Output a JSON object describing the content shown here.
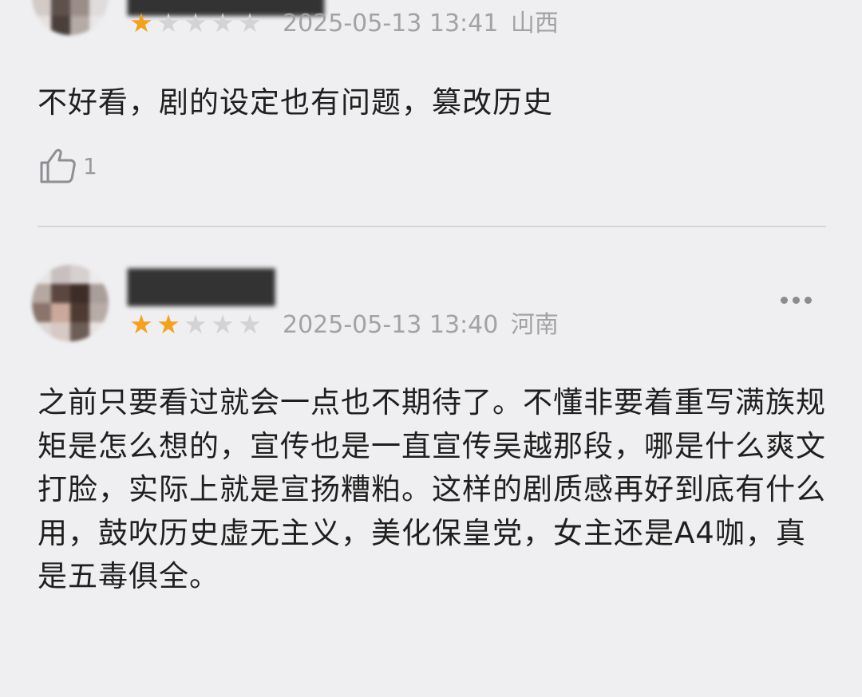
{
  "reviews": [
    {
      "rating": 1,
      "rating_max": 5,
      "timestamp": "2025-05-13 13:41",
      "location": "山西",
      "content": "不好看，剧的设定也有问题，篡改历史",
      "like_count": "1"
    },
    {
      "rating": 2,
      "rating_max": 5,
      "timestamp": "2025-05-13 13:40",
      "location": "河南",
      "content": "之前只要看过就会一点也不期待了。不懂非要着重写满族规矩是怎么想的，宣传也是一直宣传吴越那段，哪是什么爽文打脸，实际上就是宣扬糟粕。这样的剧质感再好到底有什么用，鼓吹历史虚无主义，美化保皇党，女主还是A4咖，真是五毒俱全。"
    }
  ],
  "colors": {
    "background": "#efeff1",
    "star_on": "#f4a11d",
    "star_off": "#d3d3d6",
    "meta_text": "#a2a2a6"
  },
  "icons": {
    "like": "thumbs-up-icon",
    "more": "more-dots-icon"
  }
}
